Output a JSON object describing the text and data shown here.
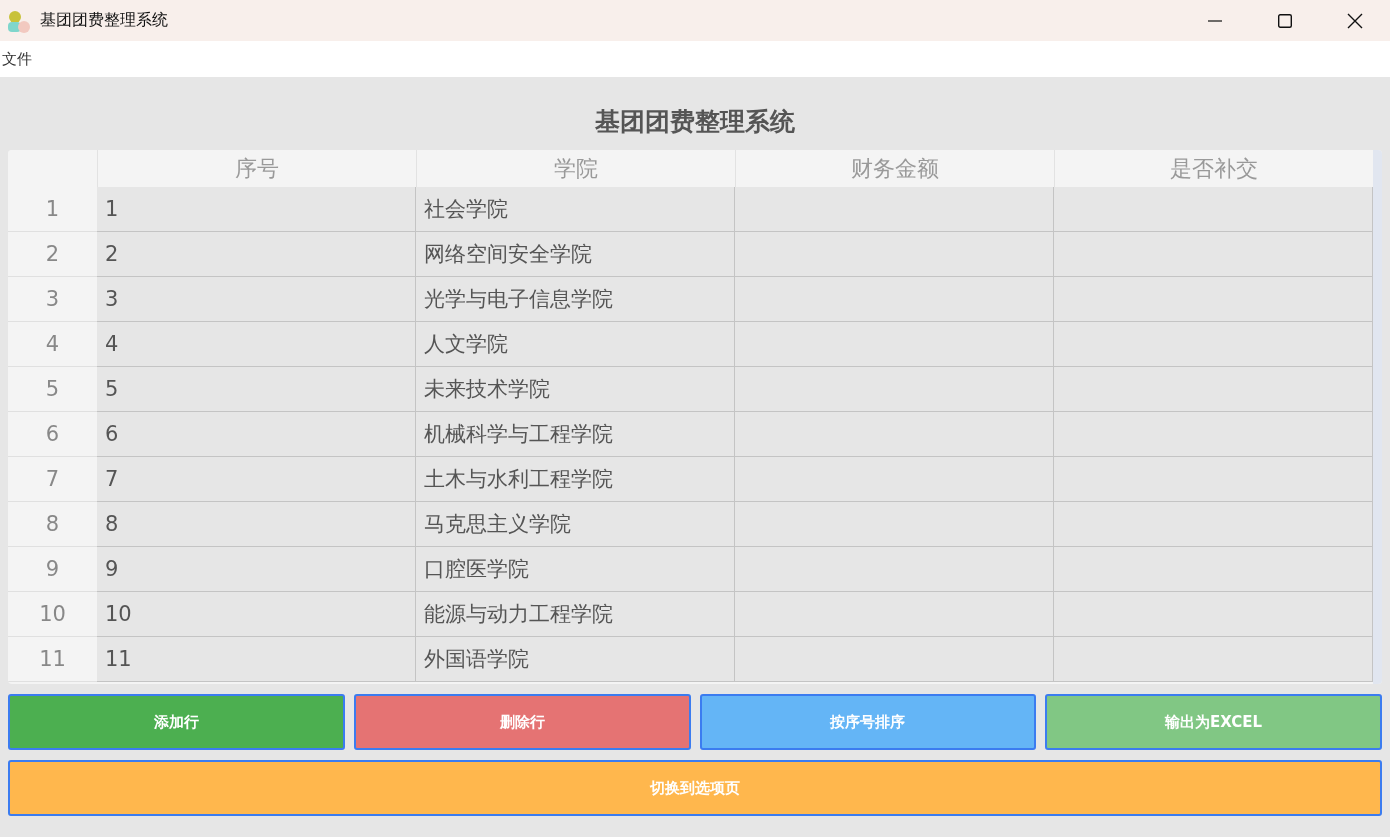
{
  "window": {
    "title": "基团团费整理系统"
  },
  "menu": [
    "文件"
  ],
  "heading": "基团团费整理系统",
  "table": {
    "columns": [
      "序号",
      "学院",
      "财务金额",
      "是否补交"
    ],
    "rows": [
      {
        "row_label": "1",
        "seq": "1",
        "college": "社会学院"
      },
      {
        "row_label": "2",
        "seq": "2",
        "college": "网络空间安全学院"
      },
      {
        "row_label": "3",
        "seq": "3",
        "college": "光学与电子信息学院"
      },
      {
        "row_label": "4",
        "seq": "4",
        "college": "人文学院"
      },
      {
        "row_label": "5",
        "seq": "5",
        "college": "未来技术学院"
      },
      {
        "row_label": "6",
        "seq": "6",
        "college": "机械科学与工程学院"
      },
      {
        "row_label": "7",
        "seq": "7",
        "college": "土木与水利工程学院"
      },
      {
        "row_label": "8",
        "seq": "8",
        "college": "马克思主义学院"
      },
      {
        "row_label": "9",
        "seq": "9",
        "college": "口腔医学院"
      },
      {
        "row_label": "10",
        "seq": "10",
        "college": "能源与动力工程学院"
      },
      {
        "row_label": "11",
        "seq": "11",
        "college": "外国语学院"
      }
    ]
  },
  "buttons": [
    {
      "label": "添加行",
      "color": "#4caf50"
    },
    {
      "label": "删除行",
      "color": "#e57373"
    },
    {
      "label": "按序号排序",
      "color": "#64b5f6"
    },
    {
      "label": "输出为EXCEL",
      "color": "#81c784"
    }
  ],
  "wide_button": {
    "label": "切换到选项页",
    "color": "#ffb74d"
  }
}
